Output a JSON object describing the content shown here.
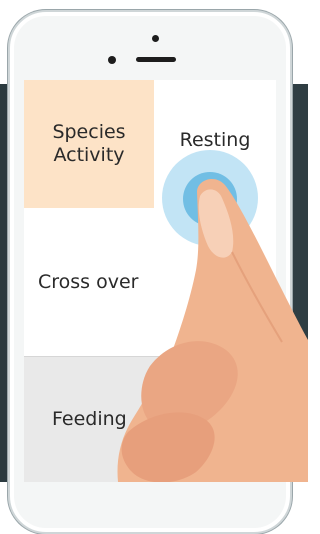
{
  "app": {
    "options": [
      {
        "label": "Species\nActivity",
        "selected": true
      },
      {
        "label": "Resting",
        "selected": false
      },
      {
        "label": "Cross over",
        "selected": false
      },
      {
        "label": "Feeding",
        "selected": false
      }
    ]
  },
  "colors": {
    "selected_bg": "#fde3c7",
    "tap_ring": "#78c4e8",
    "tile_bg": "#ffffff",
    "footer_bg": "#e9e9e9"
  },
  "icons": [
    "tap-indicator",
    "finger-hand"
  ]
}
